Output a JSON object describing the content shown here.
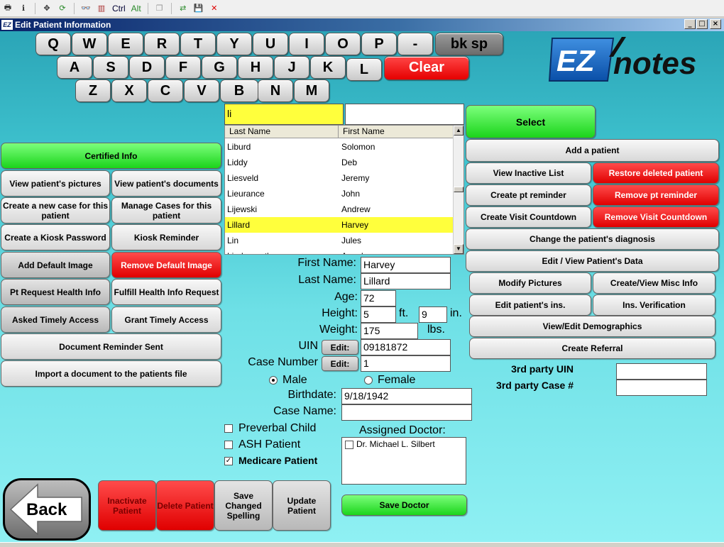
{
  "toolbar": {
    "ctrl": "Ctrl",
    "alt": "Alt"
  },
  "window": {
    "title": "Edit Patient Information",
    "icon_text": "EZ"
  },
  "keyboard": {
    "row1": [
      "Q",
      "W",
      "E",
      "R",
      "T",
      "Y",
      "U",
      "I",
      "O",
      "P",
      "-"
    ],
    "backspace": "bk sp",
    "row2": [
      "A",
      "S",
      "D",
      "F",
      "G",
      "H",
      "J",
      "K",
      "L"
    ],
    "clear": "Clear",
    "row3": [
      "Z",
      "X",
      "C",
      "V",
      "B",
      "N",
      "M"
    ]
  },
  "logo": {
    "ez": "EZ",
    "notes": "notes"
  },
  "search": {
    "last_value": "li",
    "first_value": ""
  },
  "patient_list": {
    "headers": [
      "Last Name",
      "First Name"
    ],
    "rows": [
      {
        "last": "Liburd",
        "first": "Solomon"
      },
      {
        "last": "Liddy",
        "first": "Deb"
      },
      {
        "last": "Liesveld",
        "first": "Jeremy"
      },
      {
        "last": "Lieurance",
        "first": "John"
      },
      {
        "last": "Lijewski",
        "first": "Andrew"
      },
      {
        "last": "Lillard",
        "first": "Harvey"
      },
      {
        "last": "Lin",
        "first": "Jules"
      },
      {
        "last": "Lindenmuth",
        "first": "Angela"
      }
    ],
    "selected_index": 5
  },
  "left_buttons": {
    "certified": "Certified Info",
    "view_pictures": "View patient's pictures",
    "view_documents": "View patient's documents",
    "create_case": "Create a new case for this patient",
    "manage_cases": "Manage Cases for this patient",
    "kiosk_password": "Create a Kiosk Password",
    "kiosk_reminder": "Kiosk Reminder",
    "add_default_image": "Add Default Image",
    "remove_default_image": "Remove Default Image",
    "pt_request_health": "Pt Request Health Info",
    "fulfill_health": "Fulfill Health Info Request",
    "asked_timely": "Asked Timely Access",
    "grant_timely": "Grant Timely Access",
    "doc_reminder": "Document Reminder Sent",
    "import_doc": "Import a document to the patients file"
  },
  "right_buttons": {
    "select": "Select",
    "add_patient": "Add a patient",
    "view_inactive": "View Inactive List",
    "restore_deleted": "Restore deleted patient",
    "create_reminder": "Create pt reminder",
    "remove_reminder": "Remove pt reminder",
    "create_countdown": "Create Visit Countdown",
    "remove_countdown": "Remove Visit Countdown",
    "change_diagnosis": "Change the patient's diagnosis",
    "edit_view_data": "Edit / View Patient's Data",
    "modify_pictures": "Modify Pictures",
    "create_misc": "Create/View Misc Info",
    "edit_ins": "Edit patient's ins.",
    "ins_verification": "Ins. Verification",
    "view_demographics": "View/Edit Demographics",
    "create_referral": "Create Referral"
  },
  "form": {
    "first_name_label": "First Name:",
    "first_name": "Harvey",
    "last_name_label": "Last Name:",
    "last_name": "Lillard",
    "age_label": "Age:",
    "age": "72",
    "height_label": "Height:",
    "height_ft": "5",
    "ft_label": "ft.",
    "height_in": "9",
    "in_label": "in.",
    "weight_label": "Weight:",
    "weight": "175",
    "lbs_label": "lbs.",
    "uin_label": "UIN",
    "uin": "09181872",
    "case_number_label": "Case Number",
    "case_number": "1",
    "edit_label": "Edit:",
    "male_label": "Male",
    "female_label": "Female",
    "birthdate_label": "Birthdate:",
    "birthdate": "9/18/1942",
    "case_name_label": "Case Name:",
    "case_name": "",
    "preverbal_label": "Preverbal Child",
    "ash_label": "ASH Patient",
    "medicare_label": "Medicare Patient",
    "assigned_doctor_label": "Assigned Doctor:",
    "doctor": "Dr. Michael L. Silbert",
    "third_party_uin_label": "3rd party UIN",
    "third_party_uin": "",
    "third_party_case_label": "3rd party Case #",
    "third_party_case": ""
  },
  "bottom_buttons": {
    "back": "Back",
    "inactivate": "Inactivate Patient",
    "delete": "Delete Patient",
    "save_spelling": "Save Changed Spelling",
    "update": "Update Patient",
    "save_doctor": "Save Doctor"
  }
}
